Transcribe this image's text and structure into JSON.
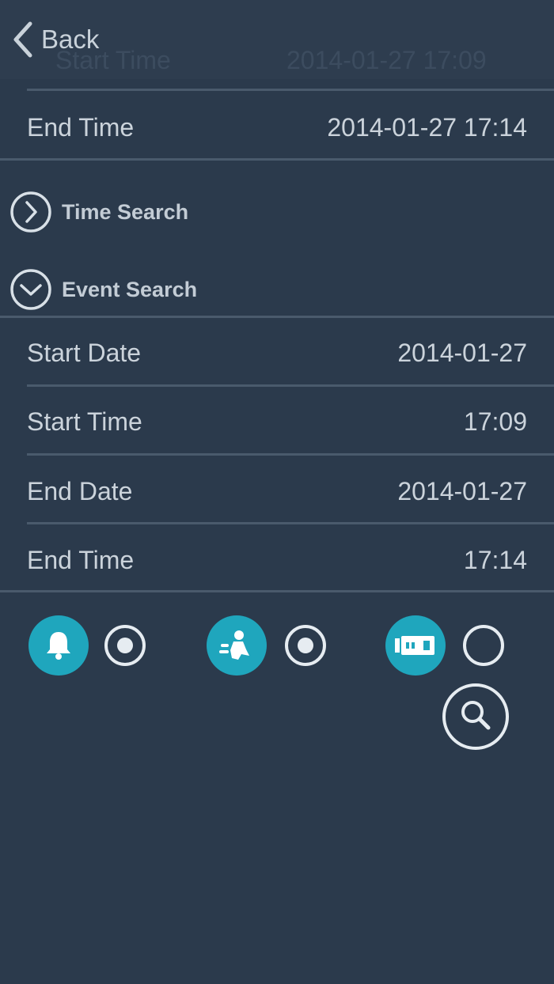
{
  "nav": {
    "back_label": "Back",
    "ghost_left": "Start Time",
    "ghost_right": "2014-01-27 17:09"
  },
  "time_search": {
    "end_time_label": "End Time",
    "end_time_value": "2014-01-27 17:14"
  },
  "sections": {
    "time_search_label": "Time Search",
    "event_search_label": "Event Search"
  },
  "event_search": {
    "rows": [
      {
        "label": "Start Date",
        "value": "2014-01-27"
      },
      {
        "label": "Start Time",
        "value": "17:09"
      },
      {
        "label": "End Date",
        "value": "2014-01-27"
      },
      {
        "label": "End Time",
        "value": "17:14"
      }
    ]
  },
  "event_types": [
    {
      "icon": "bell-icon",
      "selected": true
    },
    {
      "icon": "motion-person-icon",
      "selected": true
    },
    {
      "icon": "sensor-icon",
      "selected": false
    }
  ],
  "colors": {
    "background": "#2b3a4c",
    "accent": "#1fa6bd",
    "text": "#cbd3db",
    "divider": "#4a5a6c"
  }
}
